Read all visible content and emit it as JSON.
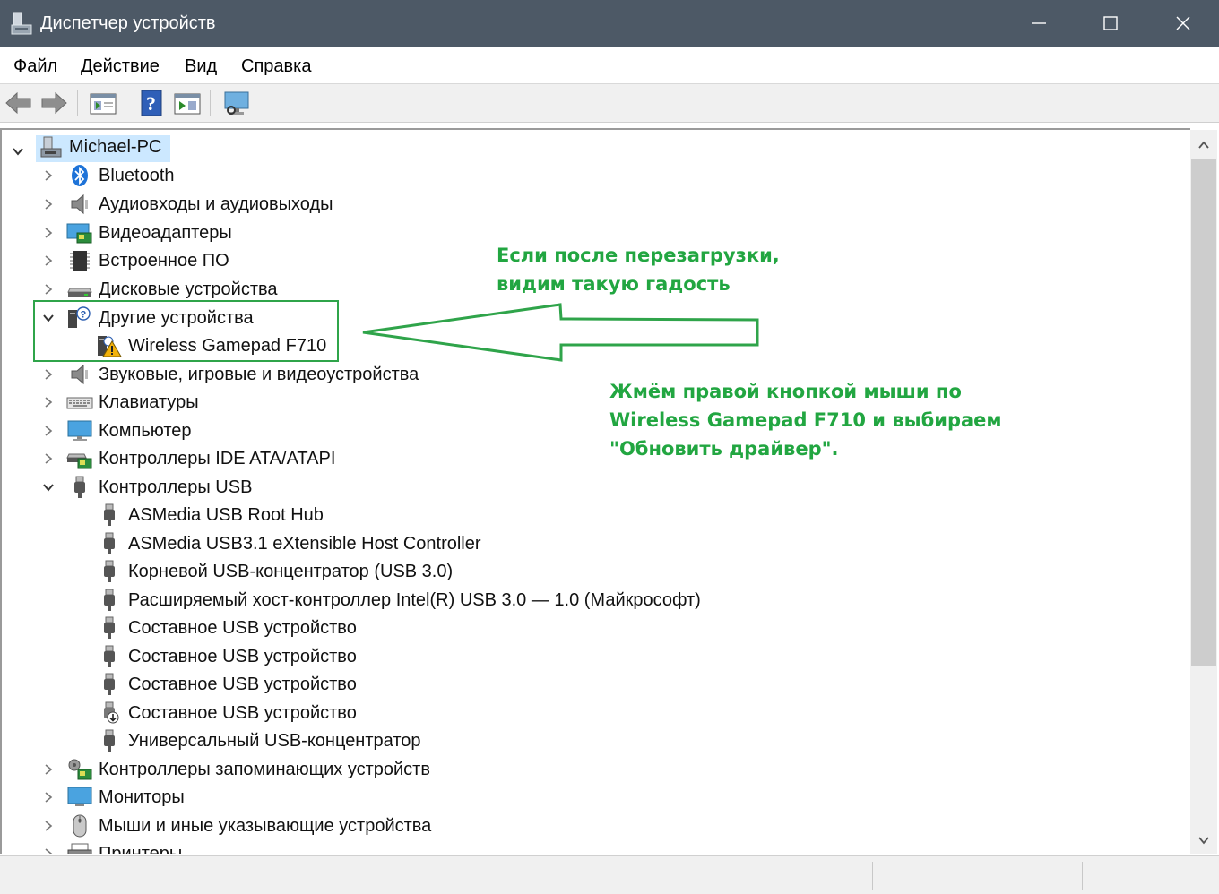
{
  "window": {
    "title": "Диспетчер устройств"
  },
  "menu": [
    "Файл",
    "Действие",
    "Вид",
    "Справка"
  ],
  "toolbar": {
    "buttons": [
      "back-arrow-icon",
      "forward-arrow-icon",
      "properties-icon",
      "help-icon",
      "update-driver-icon",
      "scan-hardware-icon"
    ]
  },
  "tree": {
    "root": "Michael-PC",
    "categories": [
      {
        "label": "Bluetooth",
        "icon": "bluetooth-icon",
        "expanded": false
      },
      {
        "label": "Аудиовходы и аудиовыходы",
        "icon": "speaker-icon",
        "expanded": false
      },
      {
        "label": "Видеоадаптеры",
        "icon": "display-adapter-icon",
        "expanded": false
      },
      {
        "label": "Встроенное ПО",
        "icon": "firmware-icon",
        "expanded": false
      },
      {
        "label": "Дисковые устройства",
        "icon": "disk-drive-icon",
        "expanded": false
      },
      {
        "label": "Другие устройства",
        "icon": "unknown-device-icon",
        "expanded": true,
        "children": [
          {
            "label": "Wireless Gamepad F710",
            "icon": "warning-device-icon"
          }
        ]
      },
      {
        "label": "Звуковые, игровые и видеоустройства",
        "icon": "speaker-icon",
        "expanded": false
      },
      {
        "label": "Клавиатуры",
        "icon": "keyboard-icon",
        "expanded": false
      },
      {
        "label": "Компьютер",
        "icon": "computer-icon",
        "expanded": false
      },
      {
        "label": "Контроллеры IDE ATA/ATAPI",
        "icon": "ide-controller-icon",
        "expanded": false
      },
      {
        "label": "Контроллеры USB",
        "icon": "usb-icon",
        "expanded": true,
        "children": [
          {
            "label": "ASMedia USB Root Hub",
            "icon": "usb-plug-icon"
          },
          {
            "label": "ASMedia USB3.1 eXtensible Host Controller",
            "icon": "usb-plug-icon"
          },
          {
            "label": "Корневой USB-концентратор (USB 3.0)",
            "icon": "usb-plug-icon"
          },
          {
            "label": "Расширяемый хост-контроллер Intel(R) USB 3.0 — 1.0 (Майкрософт)",
            "icon": "usb-plug-icon"
          },
          {
            "label": "Составное USB устройство",
            "icon": "usb-plug-icon"
          },
          {
            "label": "Составное USB устройство",
            "icon": "usb-plug-icon"
          },
          {
            "label": "Составное USB устройство",
            "icon": "usb-plug-icon"
          },
          {
            "label": "Составное USB устройство",
            "icon": "usb-download-icon"
          },
          {
            "label": "Универсальный USB-концентратор",
            "icon": "usb-plug-icon"
          }
        ]
      },
      {
        "label": "Контроллеры запоминающих устройств",
        "icon": "storage-controller-icon",
        "expanded": false
      },
      {
        "label": "Мониторы",
        "icon": "monitor-icon",
        "expanded": false
      },
      {
        "label": "Мыши и иные указывающие устройства",
        "icon": "mouse-icon",
        "expanded": false
      },
      {
        "label": "Принтеры",
        "icon": "printer-icon",
        "expanded": false
      }
    ]
  },
  "annotations": {
    "note1": [
      "Если после перезагрузки,",
      "видим такую гадость"
    ],
    "note2": [
      "Жмём правой кнопкой мыши по",
      "Wireless Gamepad F710 и выбираем",
      "\"Обновить драйвер\"."
    ],
    "color": "#22a641"
  },
  "colors": {
    "titlebar": "#4d5966",
    "selection": "#cce8ff",
    "accent_green": "#2fa44a"
  }
}
